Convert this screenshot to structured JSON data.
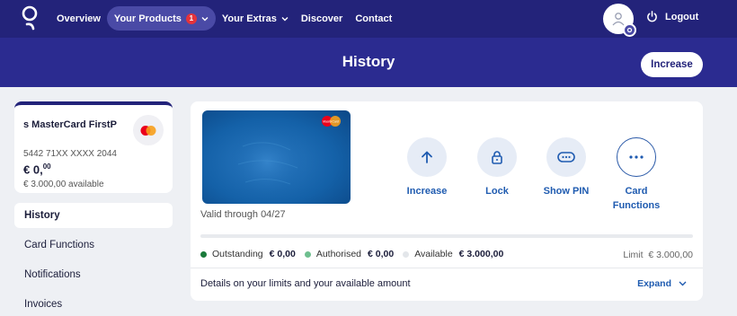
{
  "nav": {
    "items": [
      {
        "label": "Overview"
      },
      {
        "label": "Your Products",
        "badge": "1"
      },
      {
        "label": "Your Extras"
      },
      {
        "label": "Discover"
      },
      {
        "label": "Contact"
      }
    ],
    "logout_label": "Logout"
  },
  "header": {
    "title": "History",
    "increase_label": "Increase"
  },
  "card_summary": {
    "name": "s MasterCard FirstP",
    "number": "5442 71XX XXXX 2044",
    "balance_main": "€ 0,",
    "balance_cents": "00",
    "available": "€ 3.000,00 available"
  },
  "sidemenu": [
    {
      "label": "History"
    },
    {
      "label": "Card Functions"
    },
    {
      "label": "Notifications"
    },
    {
      "label": "Invoices"
    }
  ],
  "card": {
    "valid_through": "Valid through 04/27",
    "brand_text": "MasterCard"
  },
  "actions": [
    {
      "label": "Increase",
      "icon": "arrow-up-icon"
    },
    {
      "label": "Lock",
      "icon": "lock-icon"
    },
    {
      "label": "Show PIN",
      "icon": "pin-icon"
    },
    {
      "label": "Card\nFunctions",
      "icon": "more-icon"
    }
  ],
  "limits": {
    "outstanding_label": "Outstanding",
    "outstanding_value": "€ 0,00",
    "authorised_label": "Authorised",
    "authorised_value": "€ 0,00",
    "available_label": "Available",
    "available_value": "€ 3.000,00",
    "limit_text": "Limit  € 3.000,00",
    "used_fraction": 0
  },
  "details": {
    "text": "Details on your limits and your available amount",
    "expand_label": "Expand"
  },
  "colors": {
    "nav_bg": "#23237a",
    "header_bg": "#2b2b90",
    "accent_blue": "#1f5bb0",
    "outstanding_dot": "#1a7a3a",
    "authorised_dot": "#6fbf8f",
    "available_dot": "#e3e6ea"
  }
}
